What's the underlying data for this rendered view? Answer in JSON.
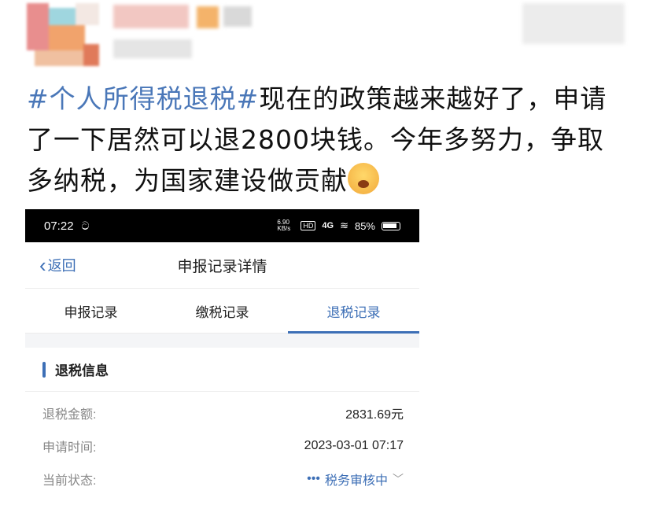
{
  "post": {
    "hashtag": "#个人所得税退税#",
    "text": "现在的政策越来越好了，申请了一下居然可以退2800块钱。今年多努力，争取多纳税，为国家建设做贡献"
  },
  "status_bar": {
    "time": "07:22",
    "weibo_icon": "weibo-icon",
    "net_speed": "6.90 KB/s",
    "hd": "HD",
    "signal": "4G",
    "battery": "85%"
  },
  "navbar": {
    "back_label": "返回",
    "title": "申报记录详情"
  },
  "tabs": [
    {
      "label": "申报记录",
      "active": false
    },
    {
      "label": "缴税记录",
      "active": false
    },
    {
      "label": "退税记录",
      "active": true
    }
  ],
  "section": {
    "title": "退税信息"
  },
  "info_rows": [
    {
      "key": "退税金额:",
      "value": "2831.69元"
    },
    {
      "key": "申请时间:",
      "value": "2023-03-01 07:17"
    },
    {
      "key": "当前状态:",
      "value": "税务审核中"
    }
  ],
  "colors": {
    "accent": "#3d6fb6",
    "hashtag": "#4a77b8"
  }
}
